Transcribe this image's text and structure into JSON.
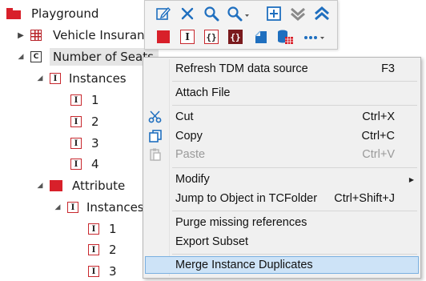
{
  "tree": {
    "root": "Playground",
    "vehicle": "Vehicle Insurance",
    "seats": "Number of Seats",
    "instances": "Instances",
    "instance_values": [
      "1",
      "2",
      "3",
      "4"
    ],
    "attribute": "Attribute",
    "attr_instances": "Instances",
    "attr_instance_values": [
      "1",
      "2",
      "3"
    ]
  },
  "toolbar": {
    "buttons": [
      "edit-icon",
      "delete-icon",
      "search-icon",
      "search-dropdown-icon",
      "add-icon",
      "collapse-icon",
      "expand-icon",
      "module-icon",
      "instance-icon",
      "curly-braces-icon",
      "attribute-braces-icon",
      "shape-icon",
      "database-table-icon",
      "more-icon"
    ]
  },
  "menu": {
    "refresh": "Refresh TDM data source",
    "refresh_sc": "F3",
    "attach": "Attach File",
    "cut": "Cut",
    "cut_sc": "Ctrl+X",
    "copy": "Copy",
    "copy_sc": "Ctrl+C",
    "paste": "Paste",
    "paste_sc": "Ctrl+V",
    "modify": "Modify",
    "jump": "Jump to Object in TCFolder",
    "jump_sc": "Ctrl+Shift+J",
    "purge": "Purge missing references",
    "export": "Export Subset",
    "merge": "Merge Instance Duplicates"
  },
  "colors": {
    "accent_red": "#d8202a",
    "highlight": "#cde3f7",
    "toolbar_blue": "#1f6fbf"
  }
}
